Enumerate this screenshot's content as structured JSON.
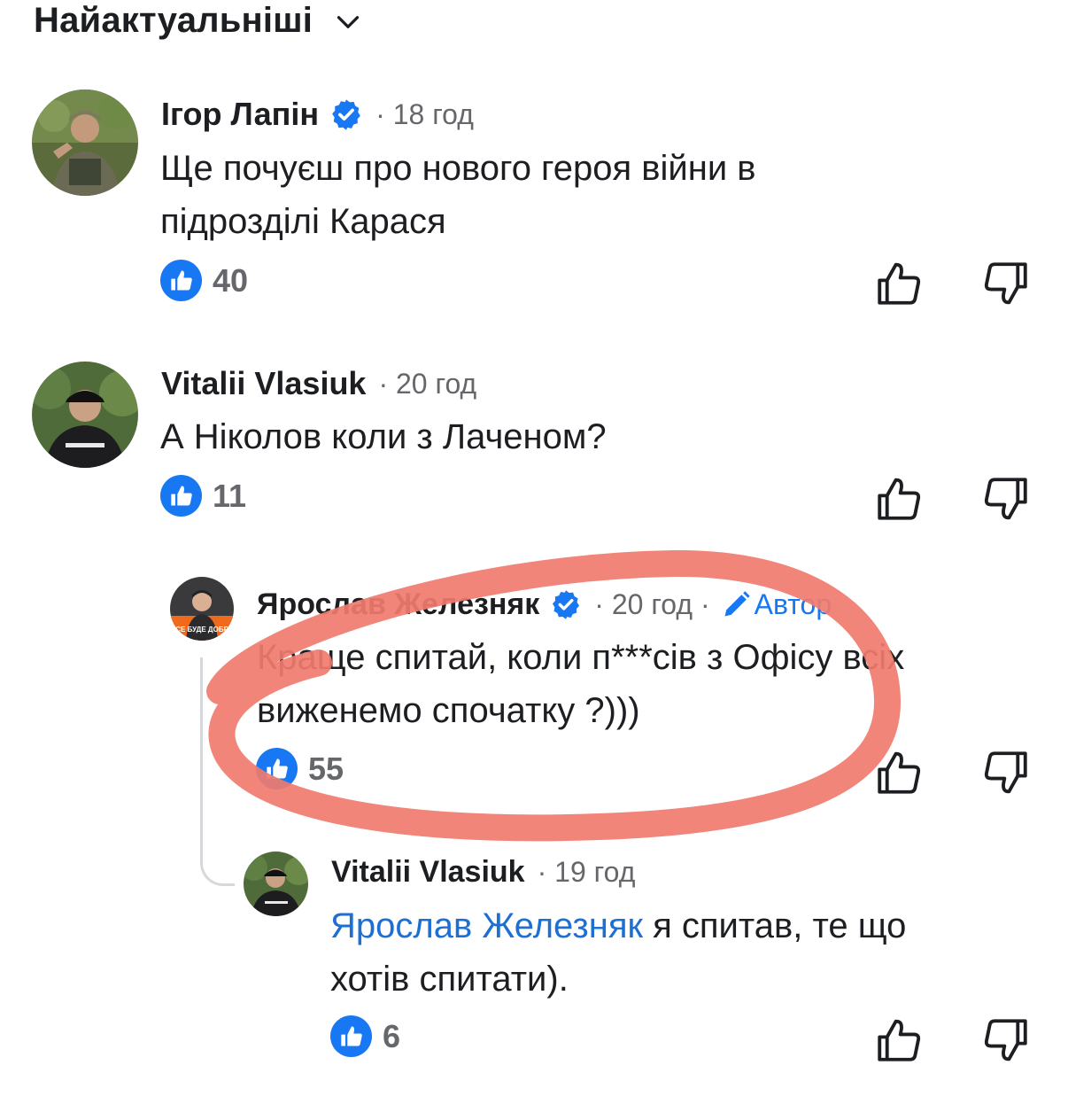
{
  "sort": {
    "label": "Найактуальніші",
    "icon": "chevron-down-icon"
  },
  "colors": {
    "accent": "#1877f2",
    "mention": "#1d6fd3",
    "meta": "#65676b",
    "annotation_red": "#f07b6e"
  },
  "comments": [
    {
      "author": "Ігор Лапін",
      "verified": true,
      "meta": "· 18 год",
      "text_lines": [
        "Ще почуєш про нового героя війни в",
        "підрозділі Карася"
      ],
      "likes": "40"
    },
    {
      "author": "Vitalii Vlasiuk",
      "verified": false,
      "meta": "· 20 год",
      "text_lines": [
        "А Ніколов коли з Лаченом?"
      ],
      "likes": "11"
    },
    {
      "author": "Ярослав Железняк",
      "verified": true,
      "meta": "· 20 год ·",
      "author_badge": "Автор",
      "avatar_caption": "ВСЕ БУДЕ ДОБРЕ",
      "text_lines": [
        "Краще спитай, коли п***сів з Офісу всіх",
        "виженемо спочатку ?)))"
      ],
      "likes": "55"
    },
    {
      "author": "Vitalii Vlasiuk",
      "verified": false,
      "meta": "· 19 год",
      "mention": "Ярослав Железняк",
      "text_lines": [
        " я спитав, те що",
        "хотів спитати)."
      ],
      "likes": "6"
    }
  ]
}
